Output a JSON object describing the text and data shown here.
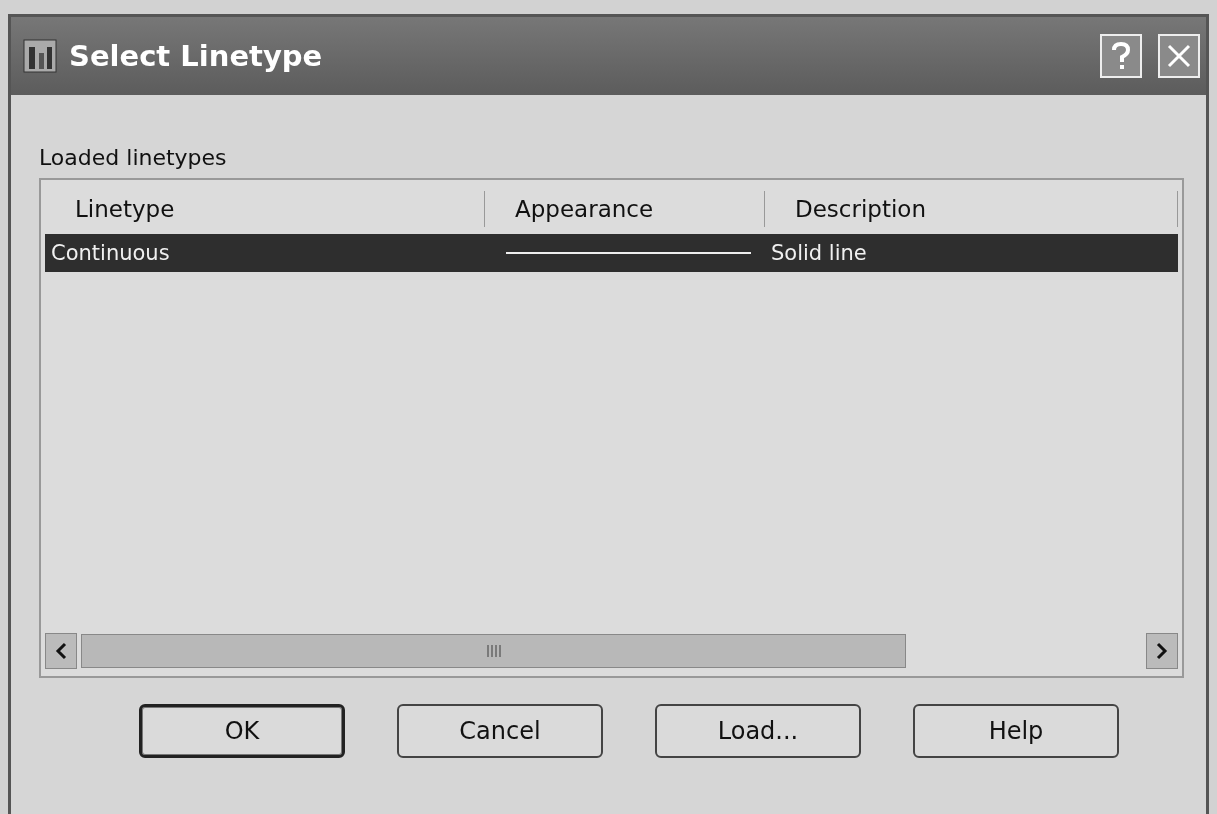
{
  "window": {
    "title": "Select Linetype"
  },
  "group_label": "Loaded linetypes",
  "table": {
    "columns": [
      "Linetype",
      "Appearance",
      "Description"
    ],
    "rows": [
      {
        "linetype": "Continuous",
        "description": "Solid line",
        "selected": true
      }
    ]
  },
  "buttons": [
    {
      "label": "OK",
      "default": true
    },
    {
      "label": "Cancel",
      "default": false
    },
    {
      "label": "Load...",
      "default": false
    },
    {
      "label": "Help",
      "default": false
    }
  ]
}
